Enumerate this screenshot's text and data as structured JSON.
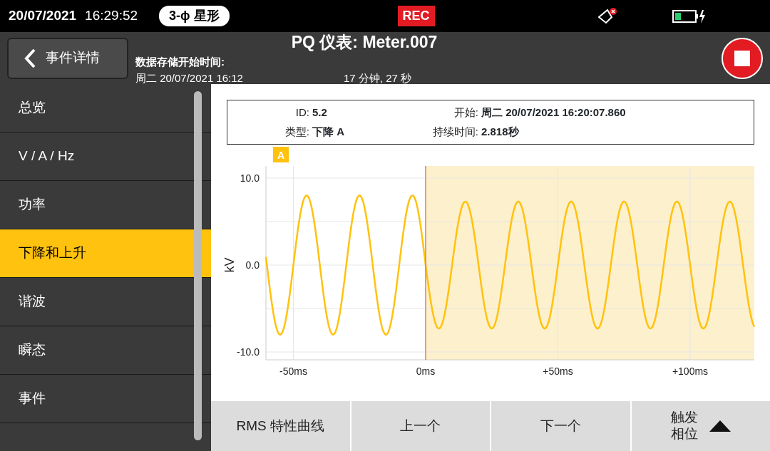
{
  "status_bar": {
    "date": "20/07/2021",
    "time": "16:29:52",
    "wiring": "3-ϕ 星形",
    "recording": "REC"
  },
  "header": {
    "back_button": "事件详情",
    "title": "PQ 仪表: Meter.007",
    "storage_label": "数据存储开始时间:",
    "storage_start": "周二 20/07/2021 16:12",
    "elapsed": "17 分钟, 27 秒"
  },
  "sidebar": {
    "items": [
      {
        "label": "总览",
        "selected": false
      },
      {
        "label": "V / A / Hz",
        "selected": false
      },
      {
        "label": "功率",
        "selected": false
      },
      {
        "label": "下降和上升",
        "selected": true
      },
      {
        "label": "谐波",
        "selected": false
      },
      {
        "label": "瞬态",
        "selected": false
      },
      {
        "label": "事件",
        "selected": false
      }
    ]
  },
  "event": {
    "fields": [
      {
        "label": "ID:",
        "value": "5.2"
      },
      {
        "label": "开始:",
        "value": "周二 20/07/2021 16:20:07.860"
      },
      {
        "label": "类型:",
        "value": "下降 A"
      },
      {
        "label": "持续时间:",
        "value": "2.818秒"
      }
    ]
  },
  "waveform": {
    "channel": "A",
    "ylabel": "kV",
    "yticks": [
      "10.0",
      "0.0",
      "-10.0"
    ],
    "xticks": [
      "-50ms",
      "0ms",
      "+50ms",
      "+100ms"
    ]
  },
  "buttons": [
    {
      "label": "RMS 特性曲线",
      "kind": "plain"
    },
    {
      "label": "上一个",
      "kind": "plain"
    },
    {
      "label": "下一个",
      "kind": "plain"
    },
    {
      "label": "触发相位",
      "kind": "menu"
    }
  ]
}
